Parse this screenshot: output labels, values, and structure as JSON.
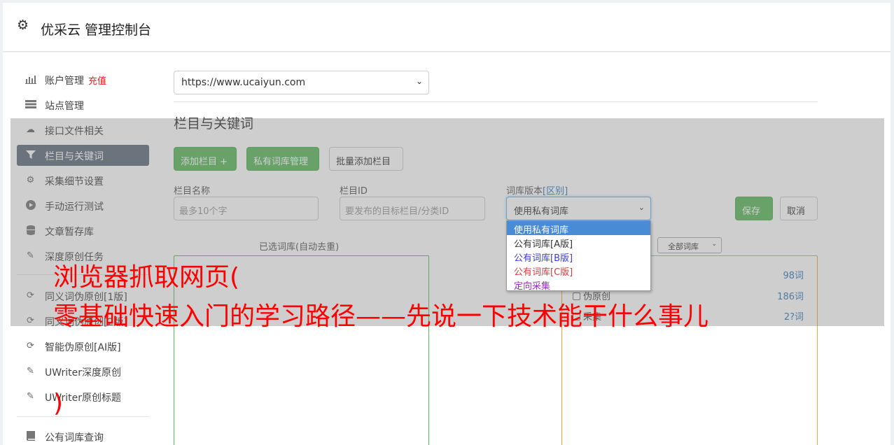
{
  "header": {
    "title": "优采云 管理控制台"
  },
  "sidebar": {
    "items": [
      {
        "icon": "bar-chart-icon",
        "label": "账户管理",
        "extra": "充值"
      },
      {
        "icon": "server-icon",
        "label": "站点管理"
      },
      {
        "icon": "cloud-upload-icon",
        "label": "接口文件相关"
      },
      {
        "icon": "filter-icon",
        "label": "栏目与关键词",
        "active": true
      },
      {
        "icon": "cogs-icon",
        "label": "采集细节设置"
      },
      {
        "icon": "play-circle-icon",
        "label": "手动运行测试"
      },
      {
        "icon": "database-icon",
        "label": "文章暂存库"
      },
      {
        "icon": "edit-icon",
        "label": "深度原创任务"
      },
      {
        "icon": "refresh-icon",
        "label": "同义词伪原创[1版]"
      },
      {
        "icon": "refresh-icon",
        "label": "同义词伪原创[2版]"
      },
      {
        "icon": "refresh-icon",
        "label": "智能伪原创[AI版]"
      },
      {
        "icon": "edit-icon",
        "label": "UWriter深度原创"
      },
      {
        "icon": "edit-icon",
        "label": "UWriter原创标题"
      },
      {
        "icon": "book-icon",
        "label": "公有词库查询"
      }
    ]
  },
  "main": {
    "site_url": "https://www.ucaiyun.com",
    "section_title": "栏目与关键词",
    "buttons": {
      "add_column": "添加栏目 +",
      "private_lib": "私有词库管理",
      "batch_add": "批量添加栏目",
      "save": "保存",
      "cancel": "取消"
    },
    "form": {
      "name_label": "栏目名称",
      "name_placeholder": "最多10个字",
      "id_label": "栏目ID",
      "id_placeholder": "要发布的目标栏目/分类ID",
      "version_label": "词库版本",
      "version_link": "[区别]",
      "version_selected": "使用私有词库",
      "version_options": [
        "使用私有词库",
        "公有词库[A版]",
        "公有词库[B版]",
        "公有词库[C版]",
        "定向采集"
      ]
    },
    "selected_title": "已选词库(自动去重)",
    "filter_select": "全部词库",
    "libraries": [
      {
        "label": "",
        "count": "98词"
      },
      {
        "label": "伪原创",
        "count": "186词"
      },
      {
        "label": "采集",
        "count": "2?词"
      }
    ]
  },
  "caption": {
    "line1": "浏览器抓取网页(",
    "line2": "零基础快速入门的学习路径——先说一下技术能干什么事儿",
    "line3": ")"
  },
  "colors": {
    "accent_green": "#5cb85c",
    "active_nav": "#5f6e7d",
    "caption_red": "#ff0000",
    "option_blue": "#3c3cd6",
    "option_red": "#d63c3c",
    "option_purple": "#9b2fc0"
  }
}
